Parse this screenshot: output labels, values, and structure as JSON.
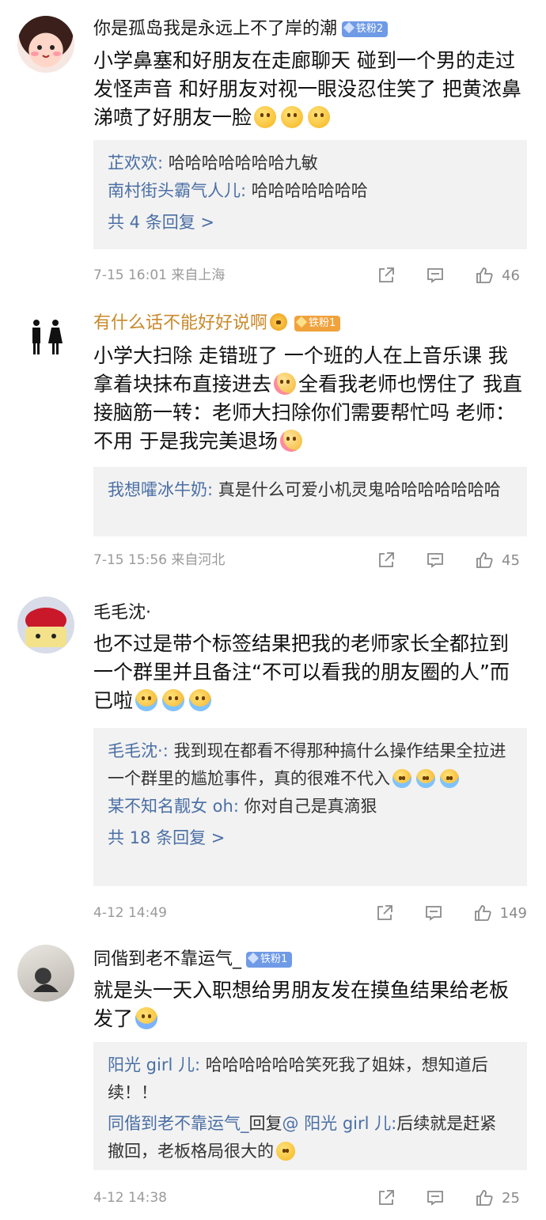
{
  "comments": [
    {
      "username": "你是孤岛我是永远上不了岸的潮",
      "badge": "铁粉2",
      "text": "小学鼻塞和好朋友在走廊聊天 碰到一个男的走过发怪声音 和好朋友对视一眼没忍住笑了 把黄浓鼻涕喷了好朋友一脸",
      "replies": [
        {
          "name": "芷欢欢",
          "sep": ": ",
          "text": "哈哈哈哈哈哈哈九敏"
        },
        {
          "name": "南村街头霸气人儿",
          "sep": ": ",
          "text": "哈哈哈哈哈哈哈"
        }
      ],
      "more": "共 4 条回复 >",
      "meta": "7-15 16:01  来自上海",
      "likes": "46"
    },
    {
      "username": "有什么话不能好好说啊",
      "badge": "铁粉1",
      "text_a": "小学大扫除 走错班了 一个班的人在上音乐课 我拿着块抹布直接进去",
      "text_b": "全看我老师也愣住了 我直接脑筋一转：老师大扫除你们需要帮忙吗 老师：不用  于是我完美退场",
      "replies": [
        {
          "name": "我想嚯冰牛奶",
          "sep": ": ",
          "text": "真是什么可爱小机灵鬼哈哈哈哈哈哈哈"
        }
      ],
      "meta": "7-15 15:56  来自河北",
      "likes": "45"
    },
    {
      "username": "毛毛沈·",
      "text": "也不过是带个标签结果把我的老师家长全都拉到一个群里并且备注“不可以看我的朋友圈的人”而已啦",
      "replies": [
        {
          "name": "毛毛沈·",
          "sep": ": ",
          "text": "我到现在都看不得那种搞什么操作结果全拉进一个群里的尴尬事件，真的很难不代入"
        },
        {
          "name": "某不知名靓女 oh",
          "sep": ": ",
          "text": "你对自己是真滴狠"
        }
      ],
      "more": "共 18 条回复 >",
      "meta": "4-12 14:49",
      "likes": "149"
    },
    {
      "username": "同偕到老不靠运气_",
      "badge": "铁粉1",
      "text": "就是头一天入职想给男朋友发在摸鱼结果给老板发了",
      "replies": [
        {
          "name": "阳光 girl 儿",
          "sep": ": ",
          "text": "哈哈哈哈哈哈笑死我了姐妹，想知道后续！！"
        },
        {
          "name": "同偕到老不靠运气_",
          "mid": "回复",
          "at": "@ 阳光 girl 儿",
          "sep": ":",
          "text": "后续就是赶紧撤回，老板格局很大的"
        }
      ],
      "meta": "4-12 14:38",
      "likes": "25"
    }
  ],
  "colors": {
    "link": "#4a6fa5",
    "gold_username": "#c98a2b",
    "meta": "#9a9a9a",
    "reply_bg": "#f2f2f2",
    "badge_blue": "#6f9ae6",
    "badge_gold": "#f0a23c"
  },
  "icons": [
    "share-icon",
    "comment-icon",
    "like-icon",
    "cry-emoji",
    "blush-emoji",
    "sweat-emoji"
  ]
}
